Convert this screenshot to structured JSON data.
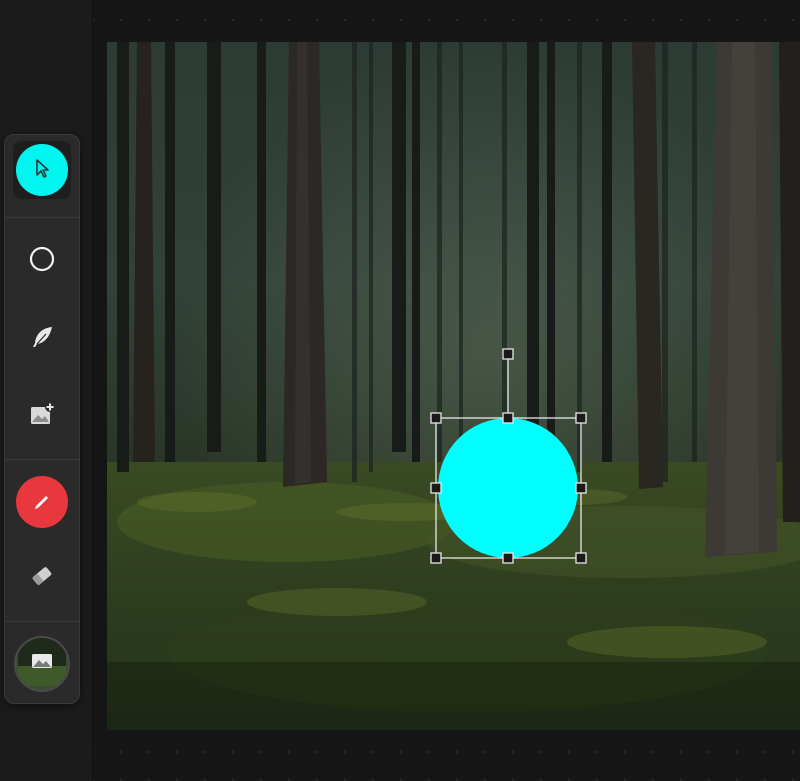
{
  "toolbar": {
    "tools": [
      {
        "id": "select",
        "icon": "cursor-icon",
        "active": true
      },
      {
        "id": "shape",
        "icon": "circle-outline-icon"
      },
      {
        "id": "draw",
        "icon": "feather-icon"
      },
      {
        "id": "add-image",
        "icon": "image-add-icon"
      },
      {
        "id": "color",
        "icon": "pencil-icon"
      },
      {
        "id": "eraser",
        "icon": "eraser-icon"
      },
      {
        "id": "background",
        "icon": "image-thumbnail-icon"
      }
    ]
  },
  "colors": {
    "accent": "#00f5f0",
    "color_swatch": "#e8383d",
    "shape_fill": "#00ffff",
    "toolbar_bg": "#2a2a2b",
    "app_bg": "#151515"
  },
  "canvas": {
    "background": "forest photo",
    "selected_shape": {
      "type": "circle",
      "fill": "#00ffff",
      "selected": true
    }
  }
}
